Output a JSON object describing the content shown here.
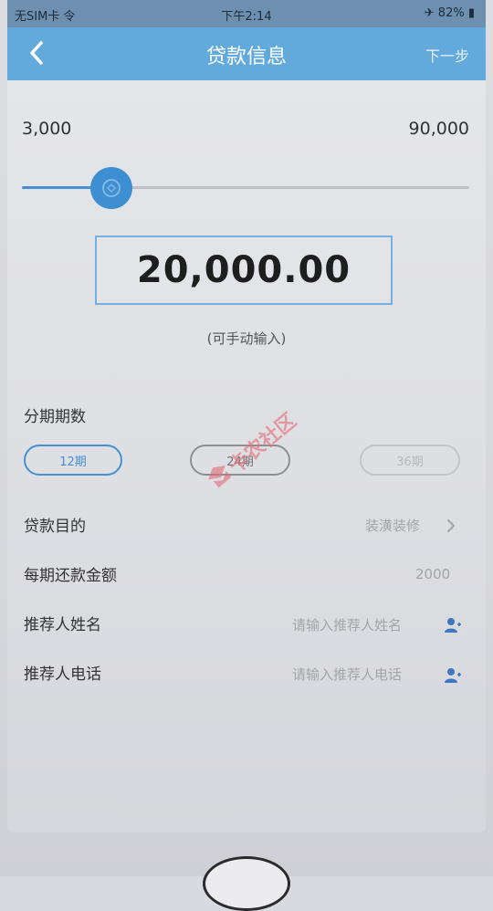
{
  "status_bar": {
    "carrier": "无SIM卡 令",
    "time": "下午2:14",
    "right": "✈ 82% ▮"
  },
  "navbar": {
    "title": "贷款信息",
    "next_label": "下一步"
  },
  "slider": {
    "min_label": "3,000",
    "max_label": "90,000",
    "fraction": 0.2
  },
  "amount": {
    "value": "20,000.00",
    "hint": "(可手动输入)"
  },
  "installments": {
    "label": "分期期数",
    "options": [
      "12期",
      "24期",
      "36期"
    ],
    "selected_index": 0
  },
  "form": {
    "purpose": {
      "label": "贷款目的",
      "value": "装潢装修"
    },
    "monthly_payment": {
      "label": "每期还款金额",
      "value": "2000"
    },
    "referrer_name": {
      "label": "推荐人姓名",
      "placeholder": "请输入推荐人姓名"
    },
    "referrer_phone": {
      "label": "推荐人电话",
      "placeholder": "请输入推荐人电话"
    }
  },
  "watermark": {
    "text": "卡农社区"
  },
  "colors": {
    "accent": "#4a8ed0",
    "navbar": "#62a9dc",
    "watermark": "#e36b76"
  },
  "icons": {
    "back": "chevron-left-icon",
    "slider_thumb": "slider-thumb-icon",
    "contact": "person-icon",
    "chevron": "chevron-right-icon"
  }
}
